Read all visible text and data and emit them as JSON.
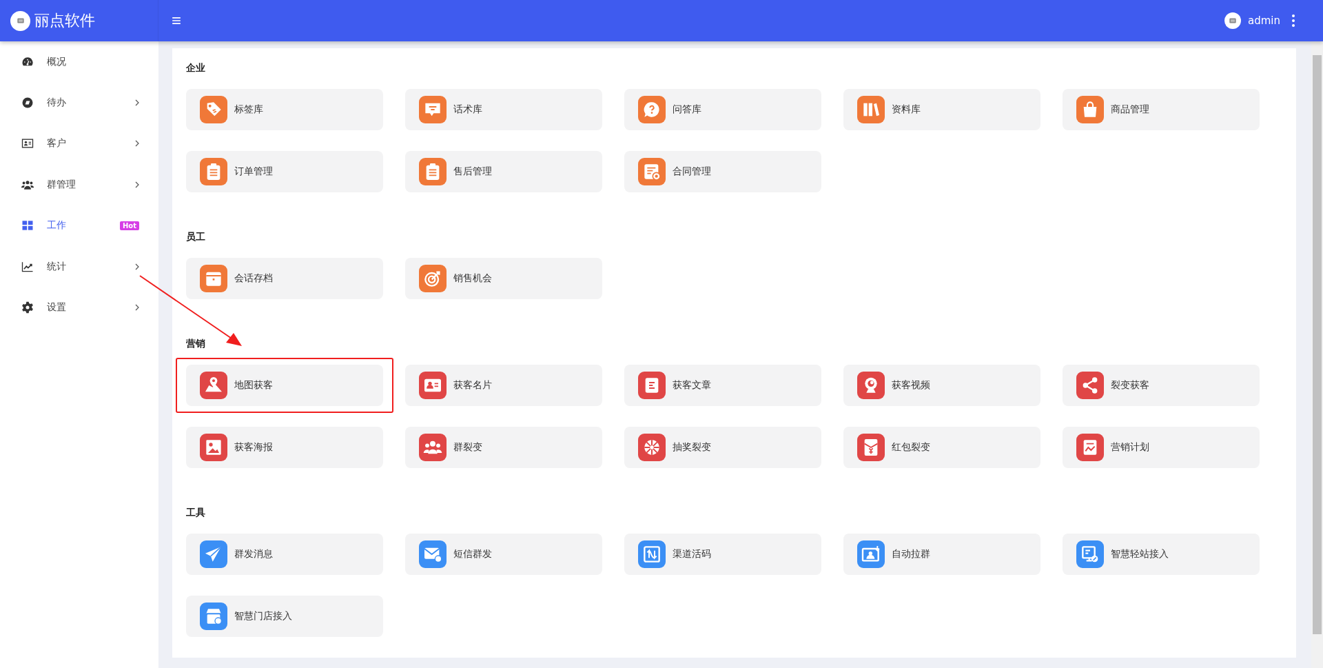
{
  "header": {
    "brand": "丽点软件",
    "user": "admin"
  },
  "sidebar": {
    "items": [
      {
        "label": "概况",
        "selected": false,
        "has_submenu": false
      },
      {
        "label": "待办",
        "selected": false,
        "has_submenu": true
      },
      {
        "label": "客户",
        "selected": false,
        "has_submenu": true
      },
      {
        "label": "群管理",
        "selected": false,
        "has_submenu": true
      },
      {
        "label": "工作",
        "selected": true,
        "has_submenu": false,
        "badge": "Hot"
      },
      {
        "label": "统计",
        "selected": false,
        "has_submenu": true
      },
      {
        "label": "设置",
        "selected": false,
        "has_submenu": true
      }
    ]
  },
  "sections": [
    {
      "title": "企业",
      "color": "#f07838",
      "items": [
        {
          "label": "标签库",
          "highlighted": false
        },
        {
          "label": "话术库",
          "highlighted": false
        },
        {
          "label": "问答库",
          "highlighted": false
        },
        {
          "label": "资料库",
          "highlighted": false
        },
        {
          "label": "商品管理",
          "highlighted": false
        },
        {
          "label": "订单管理",
          "highlighted": false
        },
        {
          "label": "售后管理",
          "highlighted": false
        },
        {
          "label": "合同管理",
          "highlighted": false
        }
      ]
    },
    {
      "title": "员工",
      "color": "#f07838",
      "items": [
        {
          "label": "会话存档",
          "highlighted": false
        },
        {
          "label": "销售机会",
          "highlighted": false
        }
      ]
    },
    {
      "title": "营销",
      "color": "#e04646",
      "items": [
        {
          "label": "地图获客",
          "highlighted": true
        },
        {
          "label": "获客名片",
          "highlighted": false
        },
        {
          "label": "获客文章",
          "highlighted": false
        },
        {
          "label": "获客视频",
          "highlighted": false
        },
        {
          "label": "裂变获客",
          "highlighted": false
        },
        {
          "label": "获客海报",
          "highlighted": false
        },
        {
          "label": "群裂变",
          "highlighted": false
        },
        {
          "label": "抽奖裂变",
          "highlighted": false
        },
        {
          "label": "红包裂变",
          "highlighted": false
        },
        {
          "label": "营销计划",
          "highlighted": false
        }
      ]
    },
    {
      "title": "工具",
      "color": "#3b8ff5",
      "items": [
        {
          "label": "群发消息",
          "highlighted": false
        },
        {
          "label": "短信群发",
          "highlighted": false
        },
        {
          "label": "渠道活码",
          "highlighted": false
        },
        {
          "label": "自动拉群",
          "highlighted": false
        },
        {
          "label": "智慧轻站接入",
          "highlighted": false
        },
        {
          "label": "智慧门店接入",
          "highlighted": false
        }
      ]
    }
  ]
}
